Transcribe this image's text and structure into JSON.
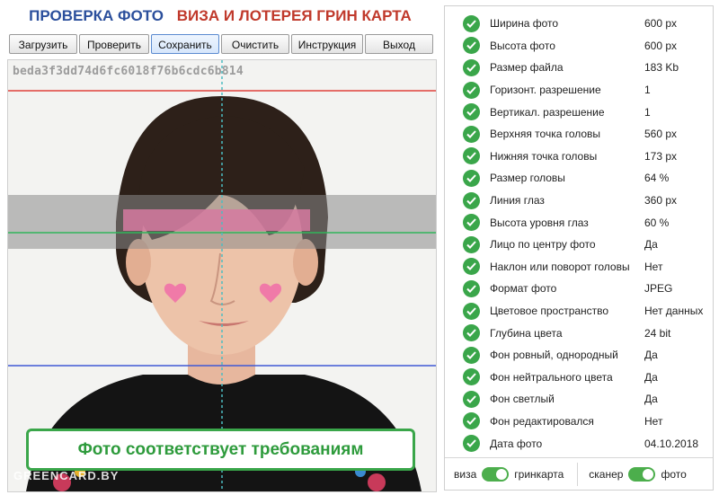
{
  "header": {
    "title_left": "ПРОВЕРКА ФОТО",
    "title_right": "ВИЗА И ЛОТЕРЕЯ ГРИН КАРТА"
  },
  "toolbar": {
    "load": "Загрузить",
    "check": "Проверить",
    "save": "Сохранить",
    "clear": "Очистить",
    "help": "Инструкция",
    "exit": "Выход"
  },
  "photo": {
    "hash": "beda3f3dd74d6fc6018f76b6cdc6b814",
    "status": "Фото соответствует требованиям",
    "watermark": "GREENCARD.BY"
  },
  "checks": [
    {
      "label": "Ширина фото",
      "value": "600 px"
    },
    {
      "label": "Высота фото",
      "value": "600 px"
    },
    {
      "label": "Размер файла",
      "value": "183 Kb"
    },
    {
      "label": "Горизонт. разрешение",
      "value": "1"
    },
    {
      "label": "Вертикал. разрешение",
      "value": "1"
    },
    {
      "label": "Верхняя точка головы",
      "value": "560 px"
    },
    {
      "label": "Нижняя точка головы",
      "value": "173 px"
    },
    {
      "label": "Размер головы",
      "value": "64 %"
    },
    {
      "label": "Линия глаз",
      "value": "360 px"
    },
    {
      "label": "Высота уровня глаз",
      "value": "60 %"
    },
    {
      "label": "Лицо по центру фото",
      "value": "Да"
    },
    {
      "label": "Наклон или поворот головы",
      "value": "Нет"
    },
    {
      "label": "Формат фото",
      "value": "JPEG"
    },
    {
      "label": "Цветовое пространство",
      "value": "Нет данных"
    },
    {
      "label": "Глубина цвета",
      "value": "24 bit"
    },
    {
      "label": "Фон ровный, однородный",
      "value": "Да"
    },
    {
      "label": "Фон нейтрального цвета",
      "value": "Да"
    },
    {
      "label": "Фон светлый",
      "value": "Да"
    },
    {
      "label": "Фон редактировался",
      "value": "Нет"
    },
    {
      "label": "Дата фото",
      "value": "04.10.2018"
    }
  ],
  "toggles": {
    "mode_left": "виза",
    "mode_right": "гринкарта",
    "source_left": "сканер",
    "source_right": "фото"
  },
  "colors": {
    "ok_green": "#3aa64a",
    "title_blue": "#2b4f9c",
    "title_red": "#c0392b"
  }
}
